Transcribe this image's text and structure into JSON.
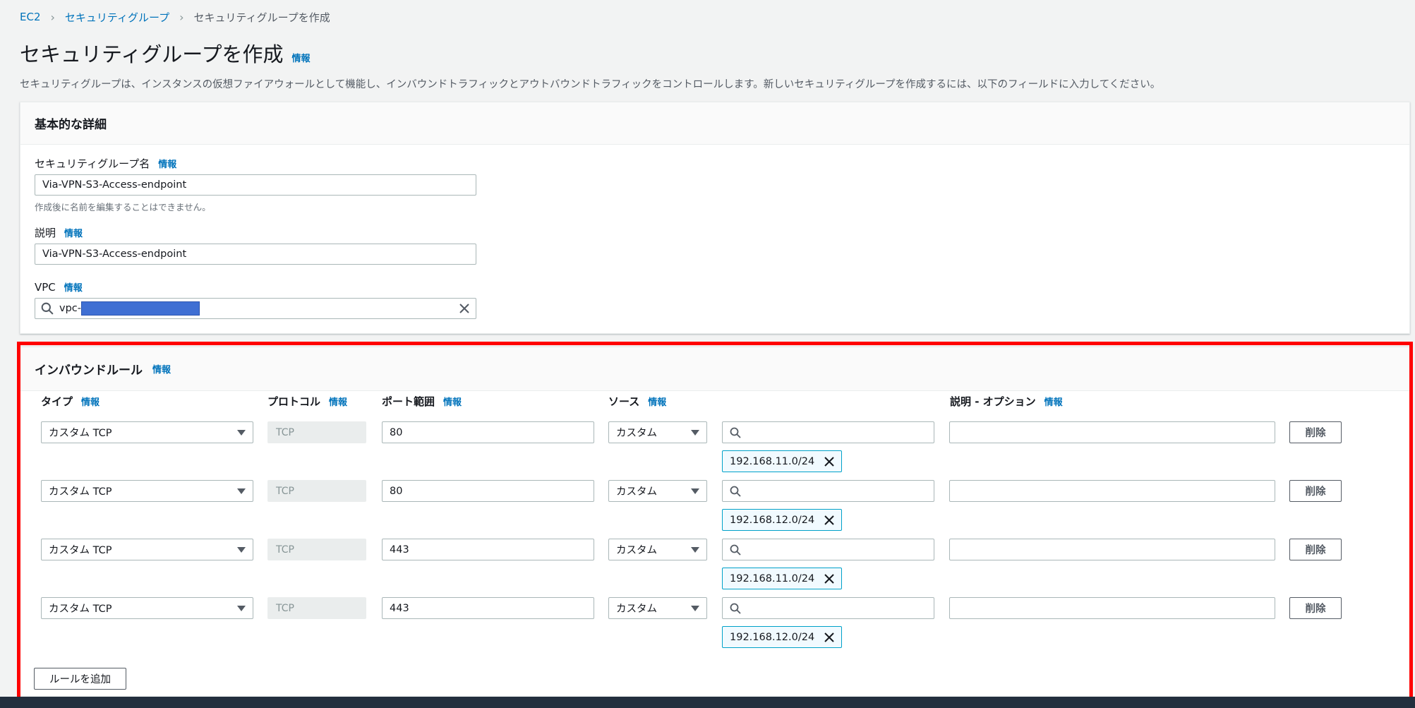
{
  "breadcrumb": {
    "items": [
      "EC2",
      "セキュリティグループ"
    ],
    "current": "セキュリティグループを作成"
  },
  "page": {
    "title": "セキュリティグループを作成",
    "info": "情報",
    "description": "セキュリティグループは、インスタンスの仮想ファイアウォールとして機能し、インバウンドトラフィックとアウトバウンドトラフィックをコントロールします。新しいセキュリティグループを作成するには、以下のフィールドに入力してください。"
  },
  "basic": {
    "header": "基本的な詳細",
    "info": "情報",
    "name_label": "セキュリティグループ名",
    "name_value": "Via-VPN-S3-Access-endpoint",
    "name_hint": "作成後に名前を編集することはできません。",
    "desc_label": "説明",
    "desc_value": "Via-VPN-S3-Access-endpoint",
    "vpc_label": "VPC",
    "vpc_value": "vpc-"
  },
  "inbound": {
    "header": "インバウンドルール",
    "info": "情報",
    "columns": {
      "type": "タイプ",
      "protocol": "プロトコル",
      "port": "ポート範囲",
      "source": "ソース",
      "desc": "説明 - オプション"
    },
    "rules": [
      {
        "type": "カスタム TCP",
        "protocol": "TCP",
        "port": "80",
        "source": "カスタム",
        "cidr": "192.168.11.0/24",
        "delete": "削除"
      },
      {
        "type": "カスタム TCP",
        "protocol": "TCP",
        "port": "80",
        "source": "カスタム",
        "cidr": "192.168.12.0/24",
        "delete": "削除"
      },
      {
        "type": "カスタム TCP",
        "protocol": "TCP",
        "port": "443",
        "source": "カスタム",
        "cidr": "192.168.11.0/24",
        "delete": "削除"
      },
      {
        "type": "カスタム TCP",
        "protocol": "TCP",
        "port": "443",
        "source": "カスタム",
        "cidr": "192.168.12.0/24",
        "delete": "削除"
      }
    ],
    "add_rule": "ルールを追加"
  },
  "icons": {
    "search": "search-icon",
    "clear": "close-icon",
    "dropdown": "caret-down-icon",
    "remove_token": "close-icon"
  },
  "colors": {
    "link": "#0073bb",
    "highlight": "#ff0000",
    "token_border": "#00a1c9"
  }
}
